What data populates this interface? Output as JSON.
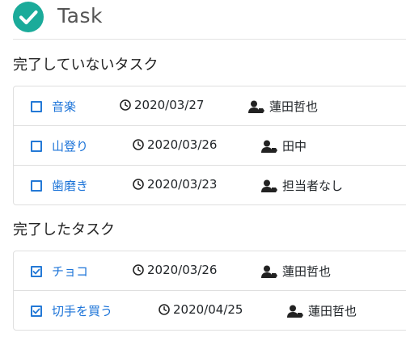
{
  "app": {
    "title": "Task"
  },
  "incomplete": {
    "heading": "完了していないタスク",
    "tasks": [
      {
        "name": "音楽",
        "date": "2020/03/27",
        "assignee": "蓮田哲也",
        "done": false
      },
      {
        "name": "山登り",
        "date": "2020/03/26",
        "assignee": "田中",
        "done": false
      },
      {
        "name": "歯磨き",
        "date": "2020/03/23",
        "assignee": "担当者なし",
        "done": false
      }
    ]
  },
  "complete": {
    "heading": "完了したタスク",
    "tasks": [
      {
        "name": "チョコ",
        "date": "2020/03/26",
        "assignee": "蓮田哲也",
        "done": true
      },
      {
        "name": "切手を買う",
        "date": "2020/04/25",
        "assignee": "蓮田哲也",
        "done": true
      }
    ]
  },
  "colors": {
    "accent": "#1b73d8",
    "logo": "#1bab9a"
  },
  "icons": {
    "logo": "check-circle-icon",
    "date": "clock-icon",
    "assignee": "user-tag-icon"
  }
}
